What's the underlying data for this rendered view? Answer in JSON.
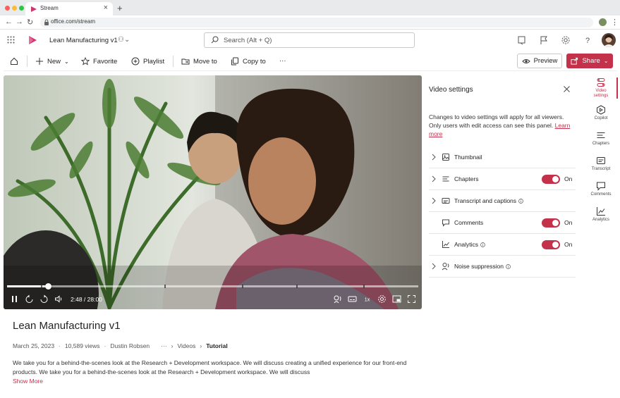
{
  "browser": {
    "tab_title": "Stream",
    "url": "office.com/stream"
  },
  "app": {
    "title": "Lean Manufacturing  v1",
    "search_placeholder": "Search (Alt + Q)"
  },
  "commands": {
    "new": "New",
    "favorite": "Favorite",
    "playlist": "Playlist",
    "move_to": "Move to",
    "copy_to": "Copy to",
    "more": "···",
    "preview": "Preview",
    "share": "Share"
  },
  "player": {
    "time": "2:48 / 28:00",
    "progress_fraction": 0.1
  },
  "video": {
    "title": "Lean Manufacturing  v1",
    "date": "March 25, 2023",
    "views": "10,589 views",
    "author": "Dustin Robsen",
    "breadcrumb_more": "···",
    "breadcrumb_folder": "Videos",
    "breadcrumb_current": "Tutorial",
    "description": "We take you for a behind-the-scenes look at the Research + Development workspace. We will discuss creating a unified experience for our front-end products. We take you for a behind-the-scenes look at the Research + Development workspace. We will discuss",
    "show_more": "Show More"
  },
  "panel": {
    "title": "Video settings",
    "description": "Changes to video settings will apply for all viewers. Only users with edit access can see this panel.",
    "learn_more": "Learn more",
    "rows": [
      {
        "label": "Thumbnail",
        "toggle": null
      },
      {
        "label": "Chapters",
        "toggle": "On"
      },
      {
        "label": "Transcript and captions",
        "toggle": null
      },
      {
        "label": "Comments",
        "toggle": "On"
      },
      {
        "label": "Analytics",
        "toggle": "On"
      },
      {
        "label": "Noise suppression",
        "toggle": null
      }
    ]
  },
  "rail": {
    "video_settings": "Video settings",
    "copilot": "Copilot",
    "chapters": "Chapters",
    "transcript": "Transcript",
    "comments": "Comments",
    "analytics": "Analytics"
  },
  "colors": {
    "accent": "#c4314b",
    "stream_logo": "#d0356d"
  }
}
